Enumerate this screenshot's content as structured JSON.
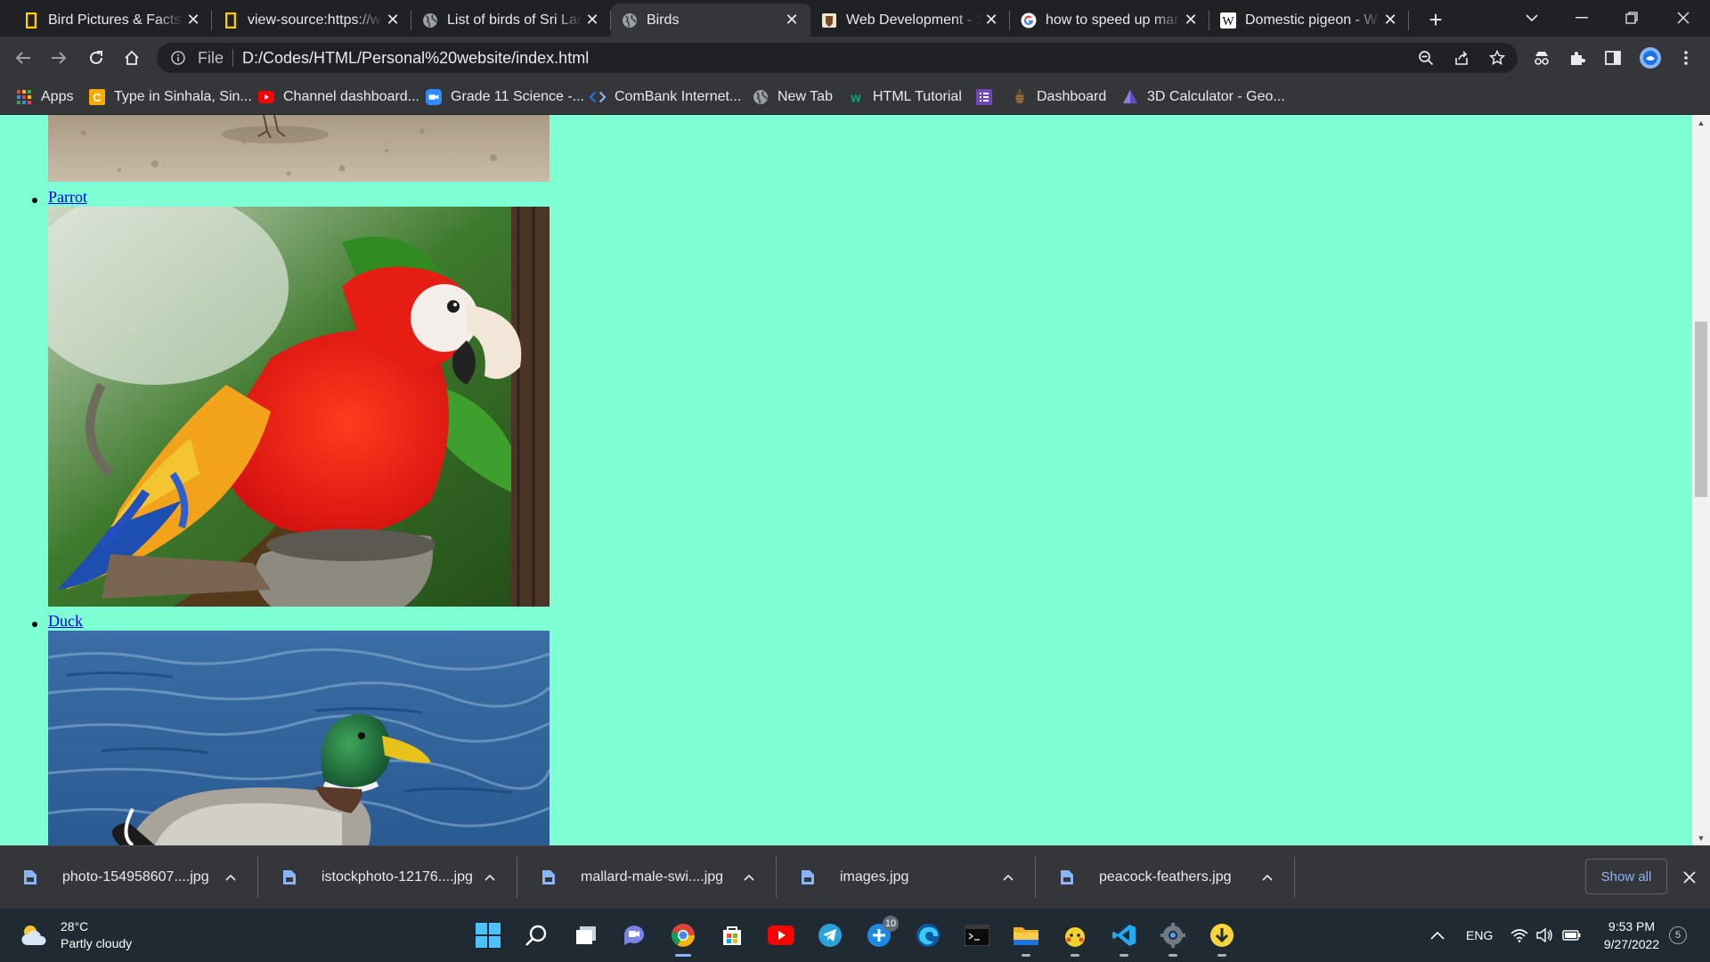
{
  "browser": {
    "tabs": [
      {
        "label": "Bird Pictures & Facts",
        "icon": "nat-geo-icon"
      },
      {
        "label": "view-source:https://w",
        "icon": "nat-geo-icon"
      },
      {
        "label": "List of birds of Sri Lan",
        "icon": "globe-icon"
      },
      {
        "label": "Birds",
        "icon": "globe-icon",
        "active": true
      },
      {
        "label": "Web Development - 1",
        "icon": "crest-icon"
      },
      {
        "label": "how to speed up mar",
        "icon": "google-icon"
      },
      {
        "label": "Domestic pigeon - W",
        "icon": "wikipedia-icon"
      }
    ],
    "address_bar": {
      "scheme_label": "File",
      "url": "D:/Codes/HTML/Personal%20website/index.html"
    },
    "bookmarks": [
      {
        "label": "Apps",
        "icon": "apps-grid-icon"
      },
      {
        "label": "Type in Sinhala, Sin...",
        "icon": "type-icon"
      },
      {
        "label": "Channel dashboard...",
        "icon": "youtube-icon"
      },
      {
        "label": "Grade 11 Science -...",
        "icon": "zoom-icon"
      },
      {
        "label": "ComBank Internet...",
        "icon": "code-icon"
      },
      {
        "label": "New Tab",
        "icon": "globe-icon"
      },
      {
        "label": "HTML Tutorial",
        "icon": "w3schools-icon"
      },
      {
        "label": "",
        "icon": "list-icon"
      },
      {
        "label": "Dashboard",
        "icon": "pinecone-icon"
      },
      {
        "label": "3D Calculator - Geo...",
        "icon": "geogebra-icon"
      }
    ]
  },
  "page": {
    "background_color": "#7fffd4",
    "link_color": "#0000ee",
    "birds": [
      {
        "name": "Parrot",
        "image": "scarlet-macaw-photo"
      },
      {
        "name": "Duck",
        "image": "mallard-duck-photo"
      }
    ]
  },
  "downloads": {
    "items": [
      {
        "filename": "photo-154958607....jpg"
      },
      {
        "filename": "istockphoto-12176....jpg"
      },
      {
        "filename": "mallard-male-swi....jpg"
      },
      {
        "filename": "images.jpg"
      },
      {
        "filename": "peacock-feathers.jpg"
      }
    ],
    "show_all_label": "Show all"
  },
  "taskbar": {
    "weather": {
      "temp": "28°C",
      "condition": "Partly cloudy"
    },
    "apps": [
      "start-icon",
      "search-icon",
      "task-view-icon",
      "teams-chat-icon",
      "chrome-icon",
      "store-icon",
      "youtube-icon",
      "telegram-icon",
      "plus-app-icon",
      "edge-icon",
      "terminal-icon",
      "file-explorer-icon",
      "pikachu-app-icon",
      "vscode-icon",
      "settings-icon",
      "downloader-icon"
    ],
    "plus_app_badge": "10",
    "language": "ENG",
    "time": "9:53 PM",
    "date": "9/27/2022",
    "notification_count": "5"
  }
}
